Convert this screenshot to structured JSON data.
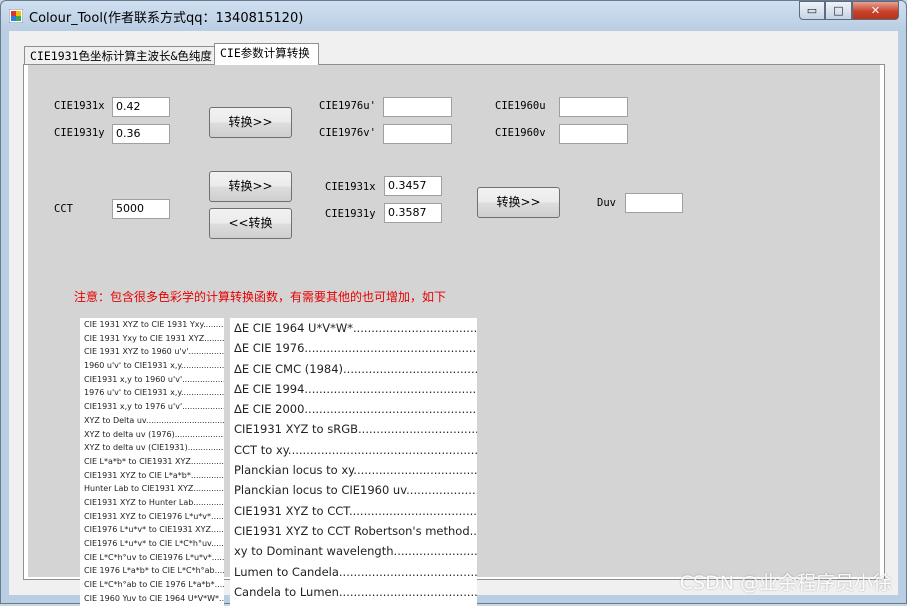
{
  "window": {
    "title": "Colour_Tool(作者联系方式qq：1340815120)",
    "controls": {
      "minimize": "▭",
      "maximize": "□",
      "close": "✕"
    }
  },
  "tabs": [
    "CIE1931色坐标计算主波长&色纯度",
    "CIE参数计算转换"
  ],
  "row1": {
    "x_label": "CIE1931x",
    "x_value": "0.42",
    "y_label": "CIE1931y",
    "y_value": "0.36",
    "convert": "转换>>",
    "u1976_label": "CIE1976u'",
    "u1976_value": "",
    "v1976_label": "CIE1976v'",
    "v1976_value": "",
    "u1960_label": "CIE1960u",
    "u1960_value": "",
    "v1960_label": "CIE1960v",
    "v1960_value": ""
  },
  "row2": {
    "cct_label": "CCT",
    "cct_value": "5000",
    "convert_fwd": "转换>>",
    "convert_back": "<<转换",
    "x_label": "CIE1931x",
    "x_value": "0.3457",
    "y_label": "CIE1931y",
    "y_value": "0.3587",
    "convert_duv": "转换>>",
    "duv_label": "Duv",
    "duv_value": ""
  },
  "note": "注意：包含很多色彩学的计算转换函数，有需要其他的也可增加，如下",
  "list_left": [
    "CIE 1931 XYZ to CIE 1931 Yxy",
    "CIE 1931 Yxy to CIE 1931 XYZ",
    "CIE 1931 XYZ to 1960 u'v'",
    "1960 u'v' to CIE1931 x,y",
    "CIE1931 x,y to 1960 u'v'",
    "1976 u'v' to CIE1931 x,y",
    "CIE1931 x,y to 1976 u'v'",
    "XYZ to Delta uv",
    "XYZ to delta uv (1976)",
    "XYZ to delta uv (CIE1931)",
    "CIE L*a*b* to CIE1931 XYZ",
    "CIE1931 XYZ  to CIE L*a*b*",
    "Hunter Lab to CIE1931 XYZ",
    "CIE1931 XYZ  to Hunter Lab",
    "CIE1931 XYZ to CIE1976 L*u*v*",
    "CIE1976 L*u*v* to CIE1931 XYZ",
    "CIE1976 L*u*v* to CIE L*C*h°uv",
    "CIE L*C*h°uv to CIE1976 L*u*v*",
    "CIE 1976 L*a*b* to CIE L*C*h°ab",
    "CIE L*C*h°ab to CIE 1976 L*a*b*",
    "CIE 1960 Yuv to CIE 1964 U*V*W*"
  ],
  "list_right": [
    "ΔE CIE 1964 U*V*W*",
    "ΔE CIE 1976",
    "ΔE CIE CMC (1984)",
    "ΔE CIE 1994",
    "ΔE CIE 2000",
    "CIE1931 XYZ to sRGB",
    "CCT to xy",
    "Planckian locus to xy",
    "Planckian locus to CIE1960 uv",
    "CIE1931 XYZ to CCT",
    "CIE1931 XYZ to CCT Robertson's method",
    "xy to Dominant wavelength",
    "Lumen to Candela",
    "Candela to Lumen"
  ],
  "watermark": "CSDN @业余程序员小徐"
}
